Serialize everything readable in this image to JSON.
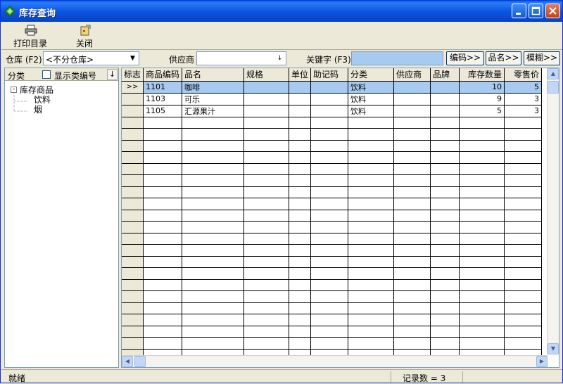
{
  "window": {
    "title": "库存查询"
  },
  "toolbar": {
    "print_label": "打印目录",
    "close_label": "关闭"
  },
  "filters": {
    "warehouse_label": "仓库 (F2)",
    "warehouse_value": "<不分仓库>",
    "supplier_label": "供应商",
    "supplier_value": "",
    "keyword_label": "关键字 (F3)",
    "keyword_value": "",
    "code_button": "编码>>",
    "name_button": "品名>>",
    "fuzzy_button": "模糊>>"
  },
  "category_pane": {
    "header_label": "分类",
    "show_code_label": "显示类编号",
    "show_code_checked": false,
    "root": "库存商品",
    "children": [
      "饮料",
      "烟"
    ]
  },
  "grid": {
    "columns": [
      "标志",
      "商品编码",
      "品名",
      "规格",
      "单位",
      "助记码",
      "分类",
      "供应商",
      "品牌",
      "库存数量",
      "零售价"
    ],
    "selected_marker": ">>",
    "rows": [
      {
        "code": "1101",
        "name": "咖啡",
        "spec": "",
        "unit": "",
        "mnemonic": "",
        "category": "饮料",
        "supplier": "",
        "brand": "",
        "qty": "10",
        "price": "5"
      },
      {
        "code": "1103",
        "name": "可乐",
        "spec": "",
        "unit": "",
        "mnemonic": "",
        "category": "饮料",
        "supplier": "",
        "brand": "",
        "qty": "9",
        "price": "3"
      },
      {
        "code": "1105",
        "name": "汇源果汁",
        "spec": "",
        "unit": "",
        "mnemonic": "",
        "category": "饮料",
        "supplier": "",
        "brand": "",
        "qty": "5",
        "price": "3"
      }
    ],
    "empty_rows": 21
  },
  "status": {
    "ready": "就绪",
    "records": "记录数 = 3"
  },
  "colors": {
    "title_bar": "#0b56e0",
    "selection": "#a6caf0",
    "window_bg": "#ece9d8"
  }
}
